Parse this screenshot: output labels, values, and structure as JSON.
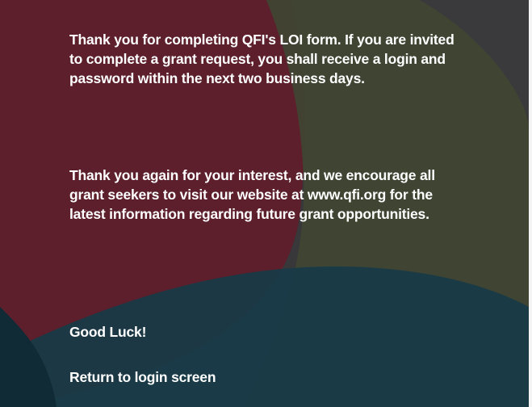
{
  "confirmation": {
    "paragraph_1": "Thank you for completing QFI's LOI form. If you are invited to complete a grant request, you shall receive a login and password within the next two business days.",
    "paragraph_2": "Thank you again for your interest, and we encourage all grant seekers to visit our website at www.qfi.org for the latest information regarding future grant opportunities.",
    "closing": "Good Luck!",
    "return_link": "Return to login screen"
  },
  "colors": {
    "background": "#38383a",
    "crimson_shape": "#5e1d2a",
    "olive_shape": "#3f4433",
    "teal_shape": "#173b48",
    "text": "#ffffff"
  }
}
